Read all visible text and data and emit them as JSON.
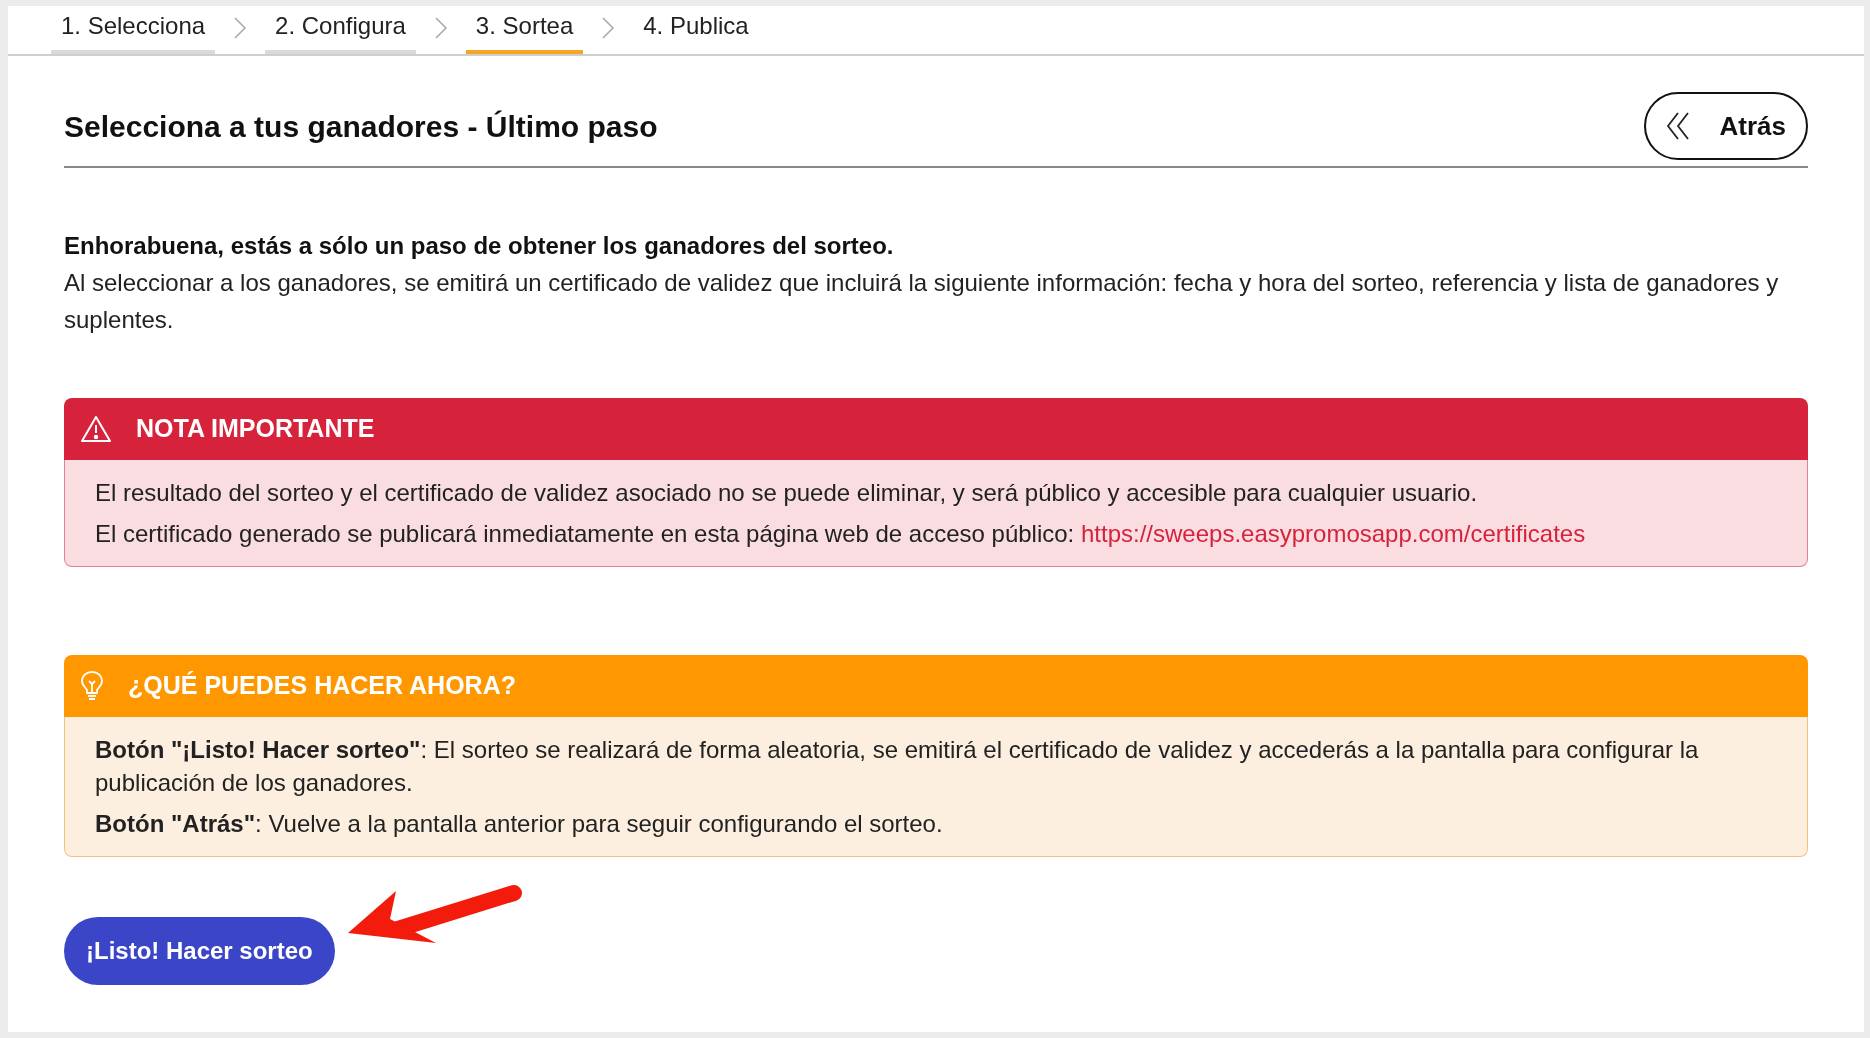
{
  "tabs": [
    {
      "label": "1. Selecciona",
      "selected": false,
      "completed": true
    },
    {
      "label": "2. Configura",
      "selected": false,
      "completed": true
    },
    {
      "label": "3. Sortea",
      "selected": true,
      "completed": false
    },
    {
      "label": "4. Publica",
      "selected": false,
      "completed": false
    }
  ],
  "header": {
    "title": "Selecciona a tus ganadores - Último paso",
    "back_button": "Atrás"
  },
  "intro": {
    "heading": "Enhorabuena, estás a sólo un paso de obtener los ganadores del sorteo.",
    "text": "Al seleccionar a los ganadores, se emitirá un certificado de validez que incluirá la siguiente información: fecha y hora del sorteo, referencia y lista de ganadores y suplentes."
  },
  "notices": [
    {
      "kind": "danger",
      "title": "NOTA IMPORTANTE",
      "lines": [
        {
          "text": "El resultado del sorteo y el certificado de validez asociado no se puede eliminar, y será público y accesible para cualquier usuario."
        },
        {
          "text": "El certificado generado se publicará inmediatamente en esta página web de acceso público:",
          "link": "https://sweeps.easypromosapp.com/certificates"
        }
      ]
    },
    {
      "kind": "tip",
      "title": "¿QUÉ PUEDES HACER AHORA?",
      "lines": [
        {
          "text": "**Botón \"¡Listo! Hacer sorteo\"**: El sorteo se realizará de forma aleatoria, se emitirá el certificado de validez y accederás a la pantalla para configurar la publicación de los ganadores."
        },
        {
          "text": "**Botón \"Atrás\"**: Vuelve a la pantalla anterior para seguir configurando el sorteo."
        }
      ]
    }
  ],
  "action_button": "¡Listo! Hacer sorteo"
}
